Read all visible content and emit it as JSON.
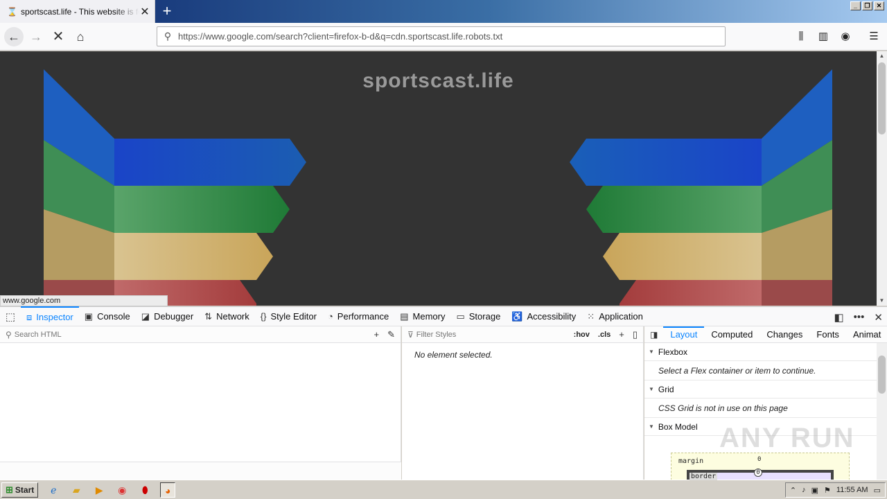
{
  "browser": {
    "tab_title": "sportscast.life - This website is for sale! - sportscast Resources and Information.",
    "tab_icon": "hourglass-icon",
    "url": "https://www.google.com/search?client=firefox-b-d&q=cdn.sportscast.life.robots.txt",
    "status_url": "www.google.com"
  },
  "page": {
    "site_title": "sportscast.life",
    "ribbon_colors": [
      "#1a44c8",
      "#1f7a36",
      "#c9a55a",
      "#a33c3c"
    ]
  },
  "devtools": {
    "tabs": [
      {
        "label": "Inspector",
        "icon": "inspector-icon",
        "glyph": "⧈",
        "active": true
      },
      {
        "label": "Console",
        "icon": "console-icon",
        "glyph": "▣",
        "active": false
      },
      {
        "label": "Debugger",
        "icon": "debugger-icon",
        "glyph": "◪",
        "active": false
      },
      {
        "label": "Network",
        "icon": "network-icon",
        "glyph": "⇅",
        "active": false
      },
      {
        "label": "Style Editor",
        "icon": "style-editor-icon",
        "glyph": "{}",
        "active": false
      },
      {
        "label": "Performance",
        "icon": "performance-icon",
        "glyph": "◔",
        "active": false
      },
      {
        "label": "Memory",
        "icon": "memory-icon",
        "glyph": "▤",
        "active": false
      },
      {
        "label": "Storage",
        "icon": "storage-icon",
        "glyph": "▭",
        "active": false
      },
      {
        "label": "Accessibility",
        "icon": "accessibility-icon",
        "glyph": "♿",
        "active": false
      },
      {
        "label": "Application",
        "icon": "application-icon",
        "glyph": "⁙",
        "active": false
      }
    ],
    "search_html_placeholder": "Search HTML",
    "filter_styles_placeholder": "Filter Styles",
    "hov": ":hov",
    "cls": ".cls",
    "no_element": "No element selected.",
    "right_tabs": [
      "Layout",
      "Computed",
      "Changes",
      "Fonts",
      "Animat"
    ],
    "sections": {
      "flexbox": "Flexbox",
      "flexbox_msg": "Select a Flex container or item to continue.",
      "grid": "Grid",
      "grid_msg": "CSS Grid is not in use on this page",
      "box_model": "Box Model"
    },
    "box_model": {
      "margin_label": "margin",
      "margin_top": "0",
      "border_label": "border",
      "border_top": "0"
    }
  },
  "watermark": "ANY RUN",
  "taskbar": {
    "start_label": "Start",
    "quick_launch": [
      "ie-icon",
      "folder-icon",
      "media-player-icon",
      "chrome-icon",
      "opera-icon",
      "firefox-icon"
    ],
    "clock": "11:55 AM"
  }
}
